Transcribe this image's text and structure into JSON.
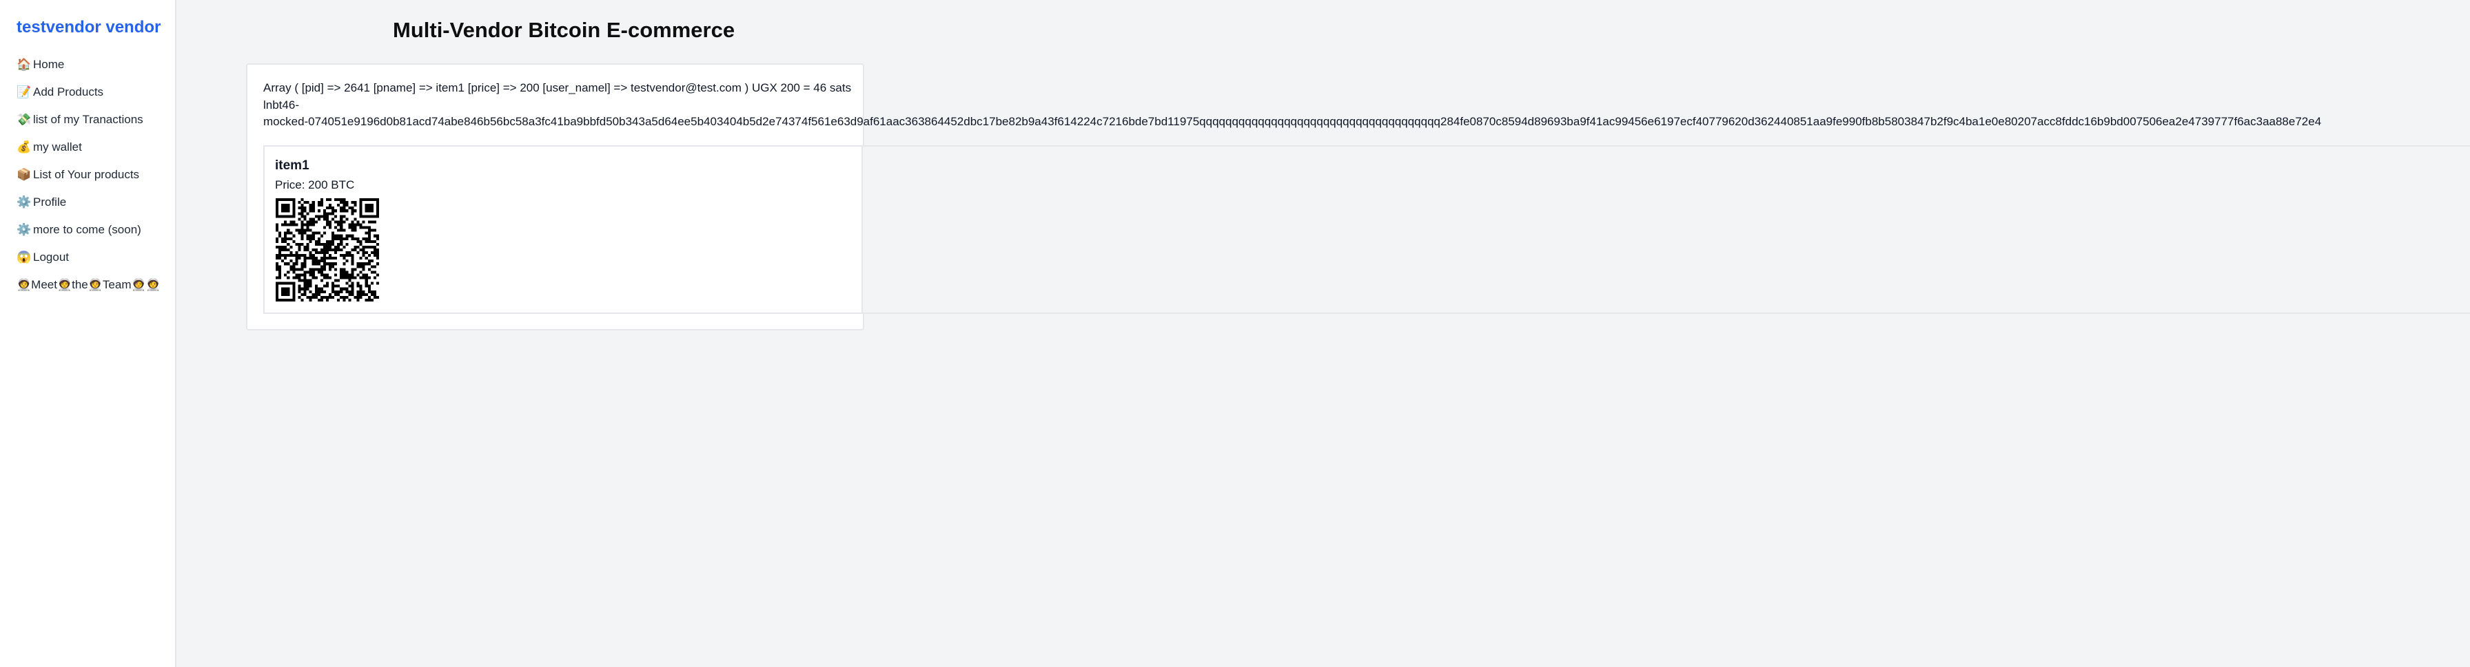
{
  "sidebar": {
    "brand": "testvendor vendor",
    "items": [
      {
        "emoji": "🏠",
        "label": "Home",
        "icon": "home-icon"
      },
      {
        "emoji": "📝",
        "label": "Add Products",
        "icon": "memo-icon"
      },
      {
        "emoji": "💸",
        "label": "list of my Tranactions",
        "icon": "money-wings-icon"
      },
      {
        "emoji": "💰",
        "label": "my wallet",
        "icon": "money-bag-icon"
      },
      {
        "emoji": "📦",
        "label": "List of Your products",
        "icon": "package-icon"
      },
      {
        "emoji": "⚙️",
        "label": "Profile",
        "icon": "gear-icon"
      },
      {
        "emoji": "⚙️",
        "label": "more to come (soon)",
        "icon": "gear-icon"
      },
      {
        "emoji": "😱",
        "label": "Logout",
        "icon": "scream-icon"
      },
      {
        "emoji": "",
        "label": "🧑‍🚀Meet🧑‍🚀the🧑‍🚀Team🧑‍🚀🧑‍🚀",
        "icon": "astronaut-icon"
      }
    ]
  },
  "main": {
    "title": "Multi-Vendor Bitcoin E-commerce",
    "debug_array": "Array ( [pid] => 2641 [pname] => item1 [price] => 200 [user_namel] => testvendor@test.com ) UGX 200 = 46 sats",
    "invoice_prefix": "lnbt46-",
    "invoice": "mocked-074051e9196d0b81acd74abe846b56bc58a3fc41ba9bbfd50b343a5d64ee5b403404b5d2e74374f561e63d9af61aac363864452dbc17be82b9a43f614224c7216bde7bd11975qqqqqqqqqqqqqqqqqqqqqqqqqqqqqqqqqqqqq284fe0870c8594d89693ba9f41ac99456e6197ecf40779620d362440851aa9fe990fb8b5803847b2f9c4ba1e0e80207acc8fddc16b9bd007506ea2e4739777f6ac3aa88e72e4",
    "product": {
      "name": "item1",
      "price": "Price: 200 BTC",
      "qr_icon": "qr-code-icon"
    }
  }
}
